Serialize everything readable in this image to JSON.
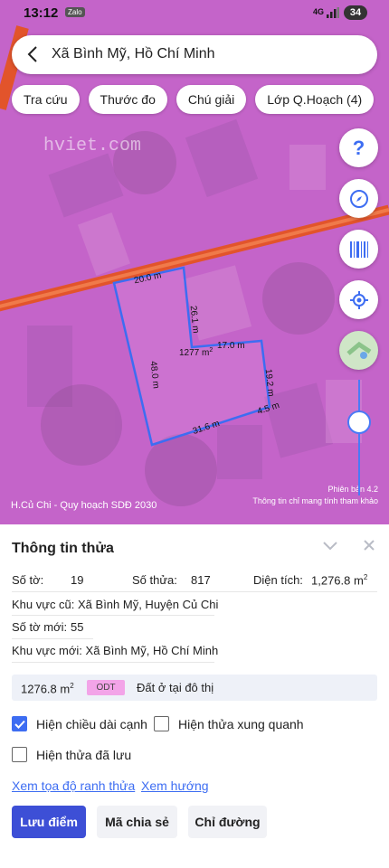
{
  "status": {
    "time": "13:12",
    "zalo": "Zalo",
    "network": "4G",
    "battery": "34"
  },
  "search": {
    "title": "Xã Bình Mỹ, Hồ Chí Minh"
  },
  "chips": [
    "Tra cứu",
    "Thước đo",
    "Chú giải",
    "Lớp Q.Hoạch (4)"
  ],
  "fabs": [
    "help",
    "compass",
    "barcode",
    "locate",
    "map-layer"
  ],
  "map": {
    "watermark": "hviet.com",
    "plot_area": "1277 m",
    "plot_area_unit": "2",
    "edges": [
      "20.0 m",
      "26.1 m",
      "17.0 m",
      "19.2 m",
      "4.5 m",
      "31.6 m",
      "48.0 m"
    ],
    "bottom_label": "H.Củ Chi - Quy hoạch SDĐ 2030",
    "version": "Phiên bản 4.2",
    "disclaimer": "Thông tin chỉ mang tính tham khảo",
    "colors": {
      "zone": "#c464c9",
      "road": "#e2542b",
      "boundary": "#3d6df2"
    }
  },
  "panel": {
    "title": "Thông tin thửa",
    "so_to_label": "Số tờ:",
    "so_to": "19",
    "so_thua_label": "Số thửa:",
    "so_thua": "817",
    "dien_tich_label": "Diện tích:",
    "dien_tich": "1,276.8 m",
    "dien_tich_unit": "2",
    "khu_vuc_cu": "Khu vực cũ: Xã Bình Mỹ, Huyện Củ Chi",
    "so_to_moi_label": "Số tờ mới:",
    "so_to_moi": "55",
    "khu_vuc_moi": "Khu vực mới: Xã Bình Mỹ, Hồ Chí Minh",
    "land_area": "1276.8 m",
    "land_area_unit": "2",
    "land_code": "ODT",
    "land_name": "Đất ở tại đô thị",
    "check_edge": "Hiện chiều dài cạnh",
    "check_neighbors": "Hiện thửa xung quanh",
    "check_saved": "Hiện thửa đã lưu",
    "link_coords": "Xem tọa độ ranh thửa",
    "link_direction": "Xem hướng",
    "btn_save": "Lưu điểm",
    "btn_share": "Mã chia sẻ",
    "btn_directions": "Chỉ đường"
  }
}
